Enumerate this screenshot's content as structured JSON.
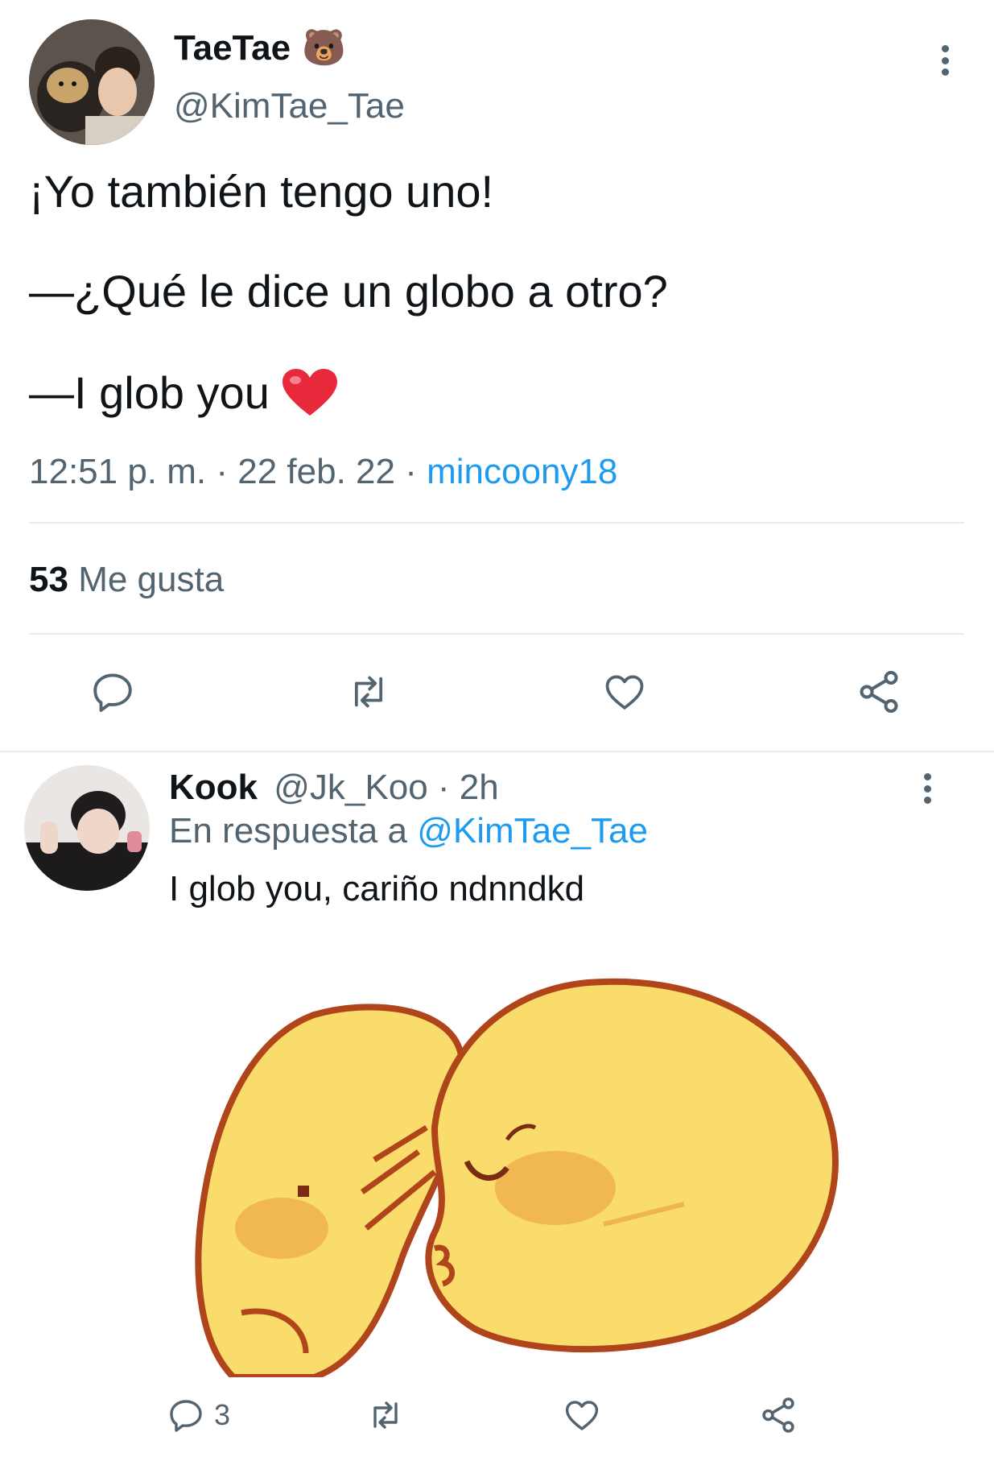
{
  "main_tweet": {
    "display_name": "TaeTae",
    "name_emoji": "🐻",
    "handle": "@KimTae_Tae",
    "lines": [
      "¡Yo también tengo uno!",
      "—¿Qué le dice un globo a otro?",
      "—I glob you"
    ],
    "heart_emoji": "❤️",
    "time": "12:51 p. m.",
    "date": "22 feb. 22",
    "sep": "·",
    "source": "mincoony18",
    "likes_count": "53",
    "likes_label": "Me gusta",
    "icons": [
      "reply-icon",
      "retweet-icon",
      "like-icon",
      "share-icon"
    ]
  },
  "reply": {
    "display_name": "Kook",
    "handle": "@Jk_Koo",
    "time": "· 2h",
    "replying_to_prefix": "En respuesta a",
    "replying_to_handle": "@KimTae_Tae",
    "text": "I glob you, cariño ndnndkd",
    "reply_count": "3",
    "icons": [
      "reply-icon",
      "retweet-icon",
      "like-icon",
      "share-icon"
    ]
  },
  "colors": {
    "text": "#0f1419",
    "muted": "#536471",
    "link": "#1d9bf0",
    "divider": "#e6ecf0",
    "chick_fill": "#f9dc6b",
    "chick_outline": "#b0451c",
    "blush": "#f0b44f"
  }
}
